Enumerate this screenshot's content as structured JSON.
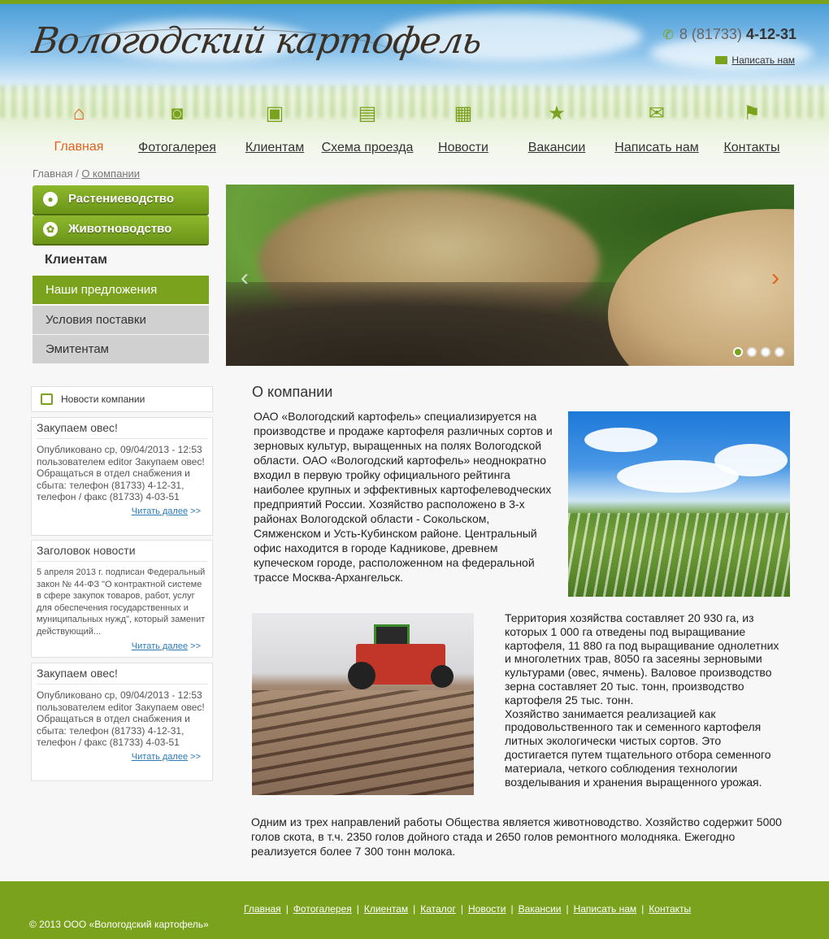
{
  "header": {
    "logo_text": "Вологодский картофель",
    "phone_prefix": "8 (81733)",
    "phone_number": "4-12-31",
    "write_us": "Написать нам"
  },
  "nav": [
    {
      "label": "Главная",
      "icon": "home-icon",
      "active": true
    },
    {
      "label": "Фотогалерея",
      "icon": "camera-icon",
      "active": false
    },
    {
      "label": "Клиентам",
      "icon": "presentation-icon",
      "active": false
    },
    {
      "label": "Схема проезда",
      "icon": "book-icon",
      "active": false
    },
    {
      "label": "Новости",
      "icon": "newspaper-icon",
      "active": false
    },
    {
      "label": "Вакансии",
      "icon": "star-icon",
      "active": false
    },
    {
      "label": "Написать нам",
      "icon": "envelope-icon",
      "active": false
    },
    {
      "label": "Контакты",
      "icon": "map-icon",
      "active": false
    }
  ],
  "breadcrumb": {
    "home": "Главная",
    "separator": " / ",
    "current": "О компании"
  },
  "sidebar": {
    "buttons": [
      {
        "label": "Растениеводство",
        "icon": "pig-icon"
      },
      {
        "label": "Животноводство",
        "icon": "flower-icon"
      }
    ],
    "section_heading": "Клиентам",
    "sub_items": [
      {
        "label": "Наши предложения",
        "active": true
      },
      {
        "label": "Условия поставки",
        "active": false
      },
      {
        "label": "Эмитентам",
        "active": false
      }
    ]
  },
  "slider": {
    "prev": "‹",
    "next": "›",
    "slides": 4,
    "active_slide": 1
  },
  "news": {
    "heading": "Новости компании",
    "items": [
      {
        "title": "Закупаем овес!",
        "body": "Опубликовано ср, 09/04/2013 - 12:53 пользователем editor Закупаем овес! Обращаться в отдел снабжения и сбыта: телефон (81733) 4-12-31, телефон / факс (81733) 4-03-51",
        "more": "Читать далее",
        "more_arrows": " >>"
      },
      {
        "title": "Заголовок новости",
        "body": "5 апреля 2013 г. подписан Федеральный закон № 44-ФЗ \"О контрактной системе в сфере закупок товаров, работ, услуг для обеспечения государственных и муниципальных нужд\", который заменит действующий...",
        "more": "Читать далее",
        "more_arrows": " >>"
      },
      {
        "title": "Закупаем овес!",
        "body": "Опубликовано ср, 09/04/2013 - 12:53 пользователем editor Закупаем овес! Обращаться в отдел снабжения и сбыта: телефон (81733) 4-12-31, телефон / факс (81733) 4-03-51",
        "more": "Читать далее",
        "more_arrows": " >>"
      }
    ]
  },
  "content": {
    "title": "О компании",
    "paragraph1": "ОАО «Вологодский картофель» специализируется на производстве и продаже картофеля различных сортов и зерновых культур, выращенных на полях Вологодской области. ОАО «Вологодский картофель» неоднократно входил в первую тройку официального рейтинга наиболее крупных и эффективных картофелеводческих предприятий России. Хозяйство расположено в 3-х районах Вологодской области - Сокольском, Сямженском и Усть-Кубинском районе. Центральный офис находится в городе Кадникове, древнем купеческом городе, расположенном на федеральной трассе Москва-Архангельск.",
    "paragraph2": "Территория хозяйства составляет 20 930 га, из которых 1 000 га отведены под выращивание картофеля, 11 880 га под выращивание однолетних и многолетних трав, 8050 га засеяны зерновыми культурами (овес, ячмень). Валовое производство зерна составляет 20 тыс. тонн, производство картофеля 25 тыс. тонн.",
    "paragraph3": "Хозяйство занимается реализацией как продовольственного так и семенного картофеля литных экологически чистых сортов. Это достигается путем тщательного отбора семенного материала, четкого соблюдения технологии возделывания и хранения выращенного урожая.",
    "paragraph4": "Одним из трех направлений работы Общества является животноводство. Хозяйство содержит 5000 голов скота, в т.ч. 2350 голов дойного стада и 2650 голов ремонтного молодняка. Ежегодно реализуется более 7 300 тонн молока."
  },
  "footer": {
    "links": [
      "Главная",
      "Фотогалерея",
      "Клиентам",
      "Каталог",
      "Новости",
      "Вакансии",
      "Написать нам",
      "Контакты"
    ],
    "separator": "|",
    "copyright": "© 2013 ООО «Вологодский картофель»"
  },
  "colors": {
    "accent": "#7aa21d",
    "active_nav": "#e0621e",
    "link": "#2a7ab8"
  }
}
